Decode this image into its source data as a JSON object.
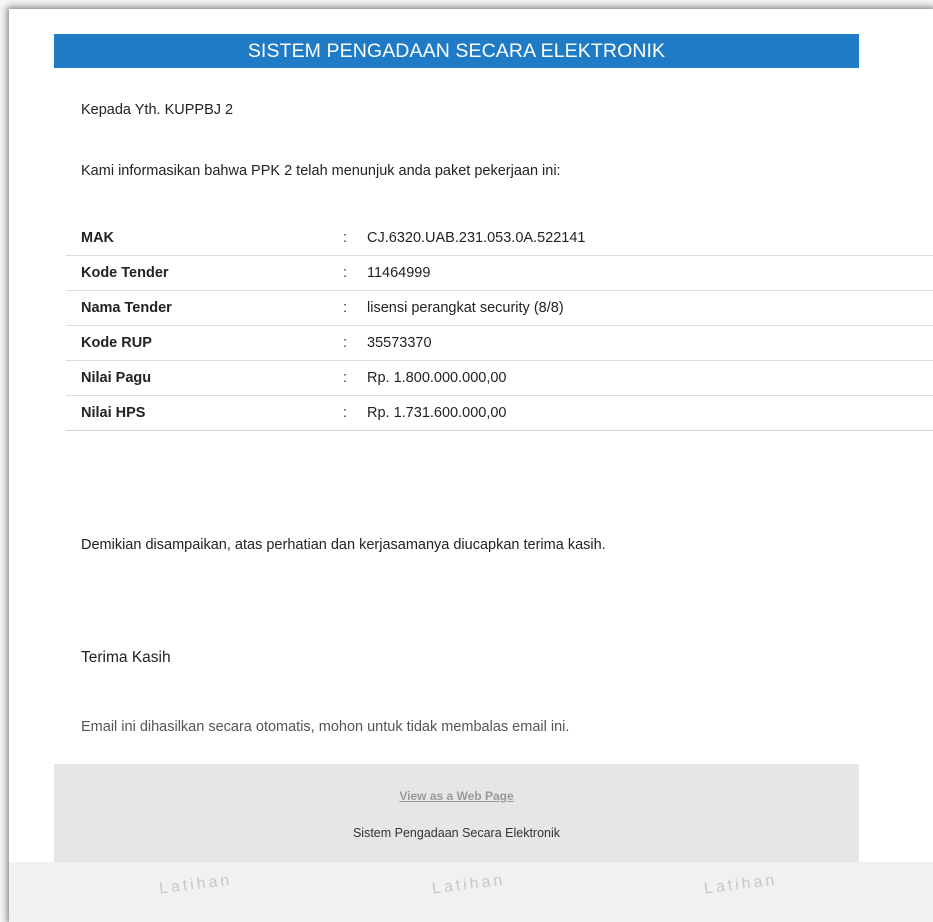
{
  "header": {
    "title": "SISTEM PENGADAAN SECARA ELEKTRONIK"
  },
  "greeting": "Kepada Yth. KUPPBJ 2",
  "intro": "Kami informasikan bahwa PPK 2 telah menunjuk anda paket pekerjaan ini:",
  "details": [
    {
      "label": "MAK",
      "sep": ":",
      "value": "CJ.6320.UAB.231.053.0A.522141"
    },
    {
      "label": "Kode Tender",
      "sep": ":",
      "value": "11464999"
    },
    {
      "label": "Nama Tender",
      "sep": ":",
      "value": "lisensi perangkat security (8/8)"
    },
    {
      "label": "Kode RUP",
      "sep": ":",
      "value": "35573370"
    },
    {
      "label": "Nilai Pagu",
      "sep": ":",
      "value": "Rp. 1.800.000.000,00"
    },
    {
      "label": "Nilai HPS",
      "sep": ":",
      "value": "Rp. 1.731.600.000,00"
    }
  ],
  "closing": "Demikian disampaikan, atas perhatian dan kerjasamanya diucapkan terima kasih.",
  "thanks": "Terima Kasih",
  "auto_note": "Email ini dihasilkan secara otomatis, mohon untuk tidak membalas email ini.",
  "footer": {
    "link_label": "View as a Web Page",
    "text": "Sistem Pengadaan Secara Elektronik"
  },
  "watermark": [
    "Latihan",
    "Latihan",
    "Latihan"
  ],
  "colors": {
    "header_bg": "#1f7bc6",
    "footer_bg": "#e6e6e6"
  }
}
